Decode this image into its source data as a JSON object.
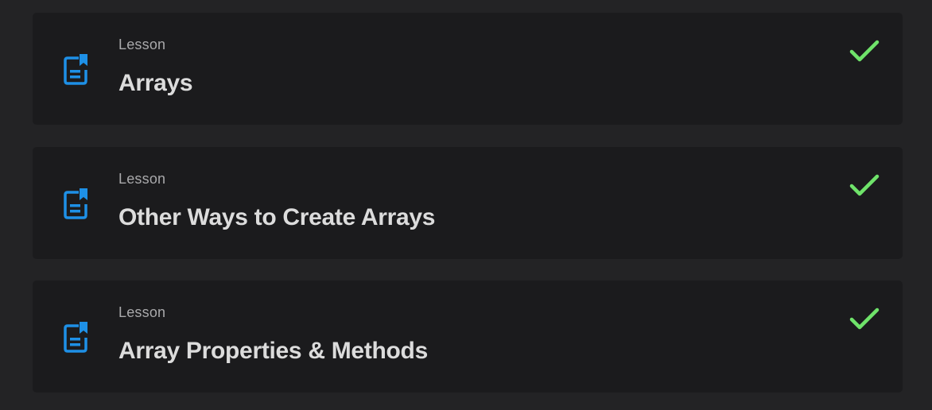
{
  "lessons": [
    {
      "kind": "Lesson",
      "title": "Arrays",
      "icon": "lesson-document-icon",
      "status_icon": "checkmark-icon",
      "completed": true
    },
    {
      "kind": "Lesson",
      "title": "Other Ways to Create Arrays",
      "icon": "lesson-document-icon",
      "status_icon": "checkmark-icon",
      "completed": true
    },
    {
      "kind": "Lesson",
      "title": "Array Properties & Methods",
      "icon": "lesson-document-icon",
      "status_icon": "checkmark-icon",
      "completed": true
    }
  ],
  "colors": {
    "page_bg": "#232325",
    "card_bg": "#1b1b1d",
    "icon_blue": "#1e90e6",
    "check_green": "#6fe36a",
    "kind_text": "#a9a9ab",
    "title_text": "#dcdcdc"
  }
}
